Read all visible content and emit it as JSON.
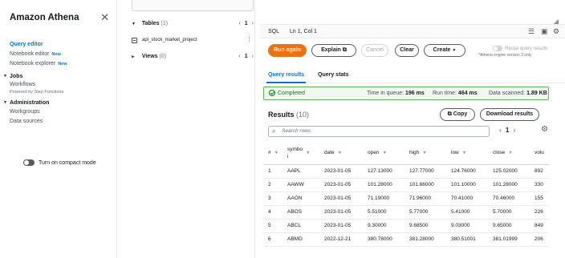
{
  "nav": {
    "title": "Amazon Athena",
    "items": [
      {
        "label": "Query editor",
        "active": true,
        "badge": ""
      },
      {
        "label": "Notebook editor",
        "active": false,
        "badge": "New"
      },
      {
        "label": "Notebook explorer",
        "active": false,
        "badge": "New"
      }
    ],
    "jobs": {
      "label": "Jobs",
      "workflows": "Workflows",
      "workflows_sub": "Powered by Step Functions"
    },
    "administration": {
      "label": "Administration",
      "workgroups": "Workgroups",
      "data_sources": "Data sources"
    },
    "compact_mode": "Turn on compact mode"
  },
  "tables_panel": {
    "tables_label": "Tables",
    "tables_count": "(1)",
    "tables_page": "1",
    "table_name": "api_stock_market_project",
    "views_label": "Views",
    "views_count": "(0)",
    "views_page": "1"
  },
  "editor": {
    "sql_label": "SQL",
    "cursor_pos": "Ln 1, Col 1"
  },
  "toolbar": {
    "run_again": "Run again",
    "explain": "Explain",
    "cancel": "Cancel",
    "clear": "Clear",
    "create": "Create",
    "reuse_label": "Reuse query results",
    "engine_note": "*Athena engine version 3 only"
  },
  "tabs": {
    "results": "Query results",
    "stats": "Query stats"
  },
  "status": {
    "state": "Completed",
    "queue_label": "Time in queue:",
    "queue_value": "196 ms",
    "run_label": "Run time:",
    "run_value": "464 ms",
    "scanned_label": "Data scanned:",
    "scanned_value": "1.89 KB"
  },
  "results": {
    "title": "Results",
    "count": "(10)",
    "copy": "Copy",
    "download": "Download results",
    "search_placeholder": "Search rows",
    "page": "1",
    "columns": [
      "#",
      "symbo\ni",
      "date",
      "open",
      "high",
      "low",
      "close",
      "volu"
    ],
    "rows": [
      [
        "1",
        "AAPL",
        "2023-01-05",
        "127.13000",
        "127.77000",
        "124.76000",
        "125.02000",
        "892"
      ],
      [
        "2",
        "AAWW",
        "2023-01-05",
        "101.28000",
        "101.66000",
        "101.10000",
        "101.28000",
        "330"
      ],
      [
        "3",
        "AAON",
        "2023-01-05",
        "71.19000",
        "71.96000",
        "70.41000",
        "70.46000",
        "155"
      ],
      [
        "4",
        "ABOS",
        "2023-01-05",
        "5.51000",
        "5.77000",
        "5.41000",
        "5.70000",
        "226"
      ],
      [
        "5",
        "ABCL",
        "2023-01-05",
        "9.30000",
        "9.68500",
        "9.03000",
        "9.65000",
        "849"
      ],
      [
        "6",
        "ABMD",
        "2022-12-21",
        "380.78000",
        "381.28000",
        "380.51001",
        "381.01999",
        "206"
      ]
    ]
  }
}
